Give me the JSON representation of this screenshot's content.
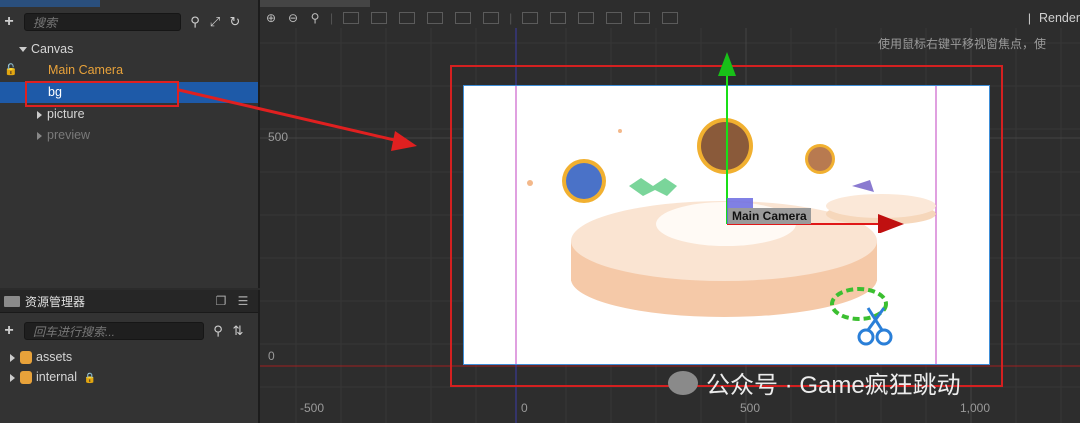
{
  "hierarchy": {
    "search_placeholder": "搜索",
    "tree": {
      "canvas": "Canvas",
      "main_camera": "Main Camera",
      "bg": "bg",
      "picture": "picture",
      "preview": "preview"
    }
  },
  "assets_panel": {
    "title": "资源管理器",
    "search_placeholder": "回车进行搜索...",
    "items": [
      "assets",
      "internal"
    ]
  },
  "scene": {
    "render_label": "Render",
    "hint": "使用鼠标右键平移视窗焦点，使",
    "y_labels": [
      "500",
      "0"
    ],
    "x_labels": [
      "-500",
      "0",
      "500",
      "1,000"
    ],
    "camera_label": "Main Camera",
    "watermark": "公众号 · Game疯狂跳动"
  },
  "colors": {
    "selection": "#1e5aa8",
    "camera_text": "#e8a23a",
    "annotation": "#e02020"
  }
}
